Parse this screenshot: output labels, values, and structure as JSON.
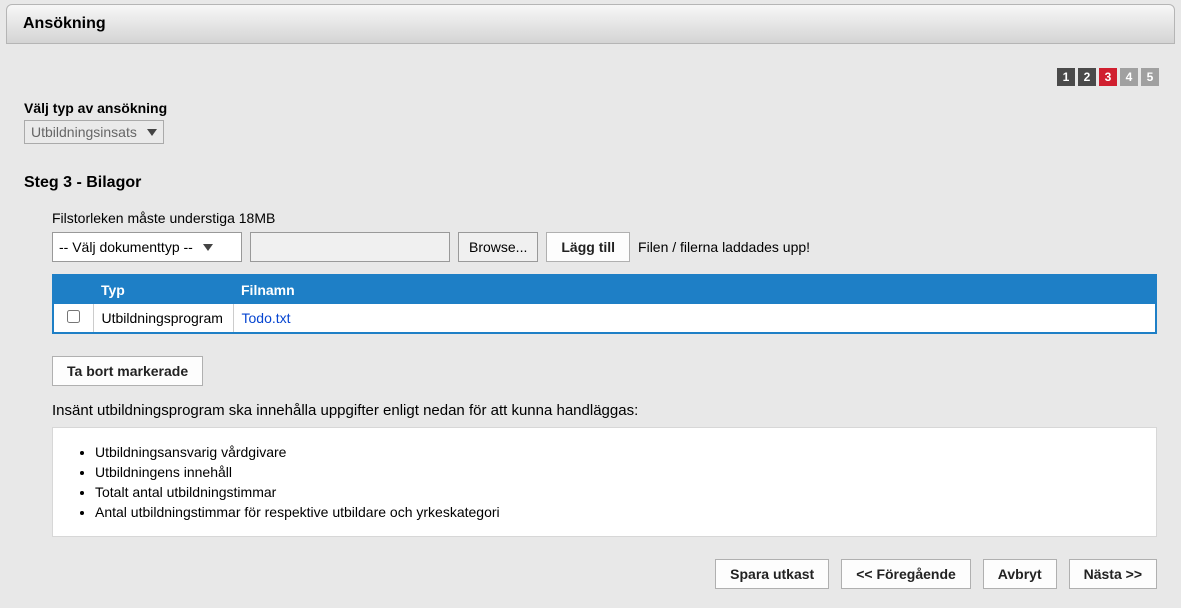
{
  "header": {
    "title": "Ansökning"
  },
  "wizard": {
    "steps": [
      "1",
      "2",
      "3",
      "4",
      "5"
    ],
    "done": [
      0,
      1
    ],
    "current": 2
  },
  "type_select": {
    "label": "Välj typ av ansökning",
    "value": "Utbildningsinsats"
  },
  "step_heading": "Steg 3 - Bilagor",
  "files": {
    "limit_note": "Filstorleken måste understiga 18MB",
    "doc_type_placeholder": "-- Välj dokumenttyp --",
    "browse_label": "Browse...",
    "add_label": "Lägg till",
    "status": "Filen / filerna laddades upp!",
    "columns": {
      "check": "",
      "type": "Typ",
      "filename": "Filnamn"
    },
    "rows": [
      {
        "type": "Utbildningsprogram",
        "filename": "Todo.txt"
      }
    ],
    "remove_label": "Ta bort markerade"
  },
  "info": {
    "intro": "Insänt utbildningsprogram ska innehålla uppgifter enligt nedan för att kunna handläggas:",
    "items": [
      "Utbildningsansvarig vårdgivare",
      "Utbildningens innehåll",
      "Totalt antal utbildningstimmar",
      "Antal utbildningstimmar för respektive utbildare och yrkeskategori"
    ]
  },
  "footer": {
    "save_draft": "Spara utkast",
    "prev": "<< Föregående",
    "cancel": "Avbryt",
    "next": "Nästa >>"
  }
}
